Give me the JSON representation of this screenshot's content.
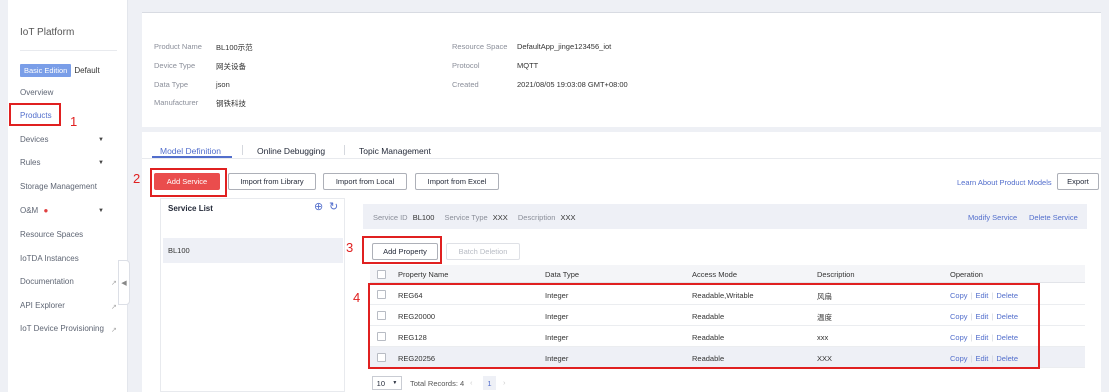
{
  "sidebar": {
    "title": "IoT Platform",
    "edition_badge": "Basic Edition",
    "edition_name": "Default",
    "items": [
      {
        "label": "Overview"
      },
      {
        "label": "Products"
      },
      {
        "label": "Devices"
      },
      {
        "label": "Rules"
      },
      {
        "label": "Storage Management"
      },
      {
        "label": "O&M"
      },
      {
        "label": "Resource Spaces"
      },
      {
        "label": "IoTDA Instances"
      },
      {
        "label": "Documentation"
      },
      {
        "label": "API Explorer"
      },
      {
        "label": "IoT Device Provisioning"
      }
    ]
  },
  "product_info": {
    "left": [
      {
        "label": "Product Name",
        "value": "BL100示范"
      },
      {
        "label": "Device Type",
        "value": "网关设备"
      },
      {
        "label": "Data Type",
        "value": "json"
      },
      {
        "label": "Manufacturer",
        "value": "钢铁科技"
      }
    ],
    "right": [
      {
        "label": "Resource Space",
        "value": "DefaultApp_jinge123456_iot"
      },
      {
        "label": "Protocol",
        "value": "MQTT"
      },
      {
        "label": "Created",
        "value": "2021/08/05 19:03:08 GMT+08:00"
      }
    ]
  },
  "tabs": [
    "Model Definition",
    "Online Debugging",
    "Topic Management"
  ],
  "toolbar": {
    "add_service": "Add Service",
    "import_library": "Import from Library",
    "import_local": "Import from Local",
    "import_excel": "Import from Excel",
    "learn_link": "Learn About Product Models",
    "export": "Export"
  },
  "service_list": {
    "title": "Service List",
    "items": [
      "BL100"
    ]
  },
  "service_header": {
    "id_label": "Service ID",
    "id_value": "BL100",
    "type_label": "Service Type",
    "type_value": "XXX",
    "desc_label": "Description",
    "desc_value": "XXX",
    "modify": "Modify Service",
    "delete": "Delete Service"
  },
  "property_actions": {
    "add": "Add Property",
    "batch_delete": "Batch Deletion"
  },
  "table": {
    "headers": [
      "Property Name",
      "Data Type",
      "Access Mode",
      "Description",
      "Operation"
    ],
    "rows": [
      {
        "name": "REG64",
        "type": "Integer",
        "access": "Readable,Writable",
        "desc": "风扇"
      },
      {
        "name": "REG20000",
        "type": "Integer",
        "access": "Readable",
        "desc": "温度"
      },
      {
        "name": "REG128",
        "type": "Integer",
        "access": "Readable",
        "desc": "xxx"
      },
      {
        "name": "REG20256",
        "type": "Integer",
        "access": "Readable",
        "desc": "XXX"
      }
    ],
    "ops": {
      "copy": "Copy",
      "edit": "Edit",
      "delete": "Delete"
    }
  },
  "pagination": {
    "page_size": "10",
    "total": "Total Records: 4",
    "current": "1"
  },
  "steps": [
    "1",
    "2",
    "3",
    "4"
  ],
  "colors": {
    "accent": "#526ecc",
    "primary_button": "#ea4d4d",
    "annotation": "#e02020"
  },
  "icons": {
    "o_and_m_dot": "red-dot",
    "add_service_icon": "plus-circle-icon",
    "refresh_icon": "refresh-icon"
  }
}
